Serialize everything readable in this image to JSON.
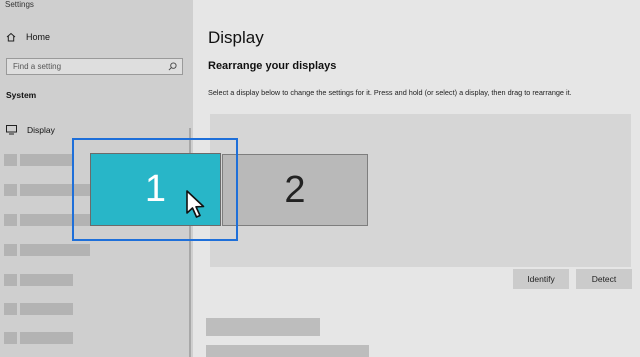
{
  "window": {
    "title": "Settings"
  },
  "sidebar": {
    "home_label": "Home",
    "search_placeholder": "Find a setting",
    "section_label": "System",
    "display_label": "Display",
    "placeholder_rows": [
      {
        "bar": 53
      },
      {
        "bar": 105
      },
      {
        "bar": 70
      },
      {
        "bar": 70
      },
      {
        "bar": 53
      },
      {
        "bar": 53
      },
      {
        "bar": 53
      }
    ]
  },
  "main": {
    "page_title": "Display",
    "section_title": "Rearrange your displays",
    "description": "Select a display below to change the settings for it. Press and hold (or select) a display, then drag to rearrange it.",
    "monitors": [
      {
        "label": "1",
        "selected": true,
        "color": "#28b6c8"
      },
      {
        "label": "2",
        "selected": false,
        "color": "#b9b9b9"
      }
    ],
    "buttons": {
      "identify": "Identify",
      "detect": "Detect"
    }
  },
  "colors": {
    "accent": "#1e6fd9",
    "selected_display": "#28b6c8"
  }
}
